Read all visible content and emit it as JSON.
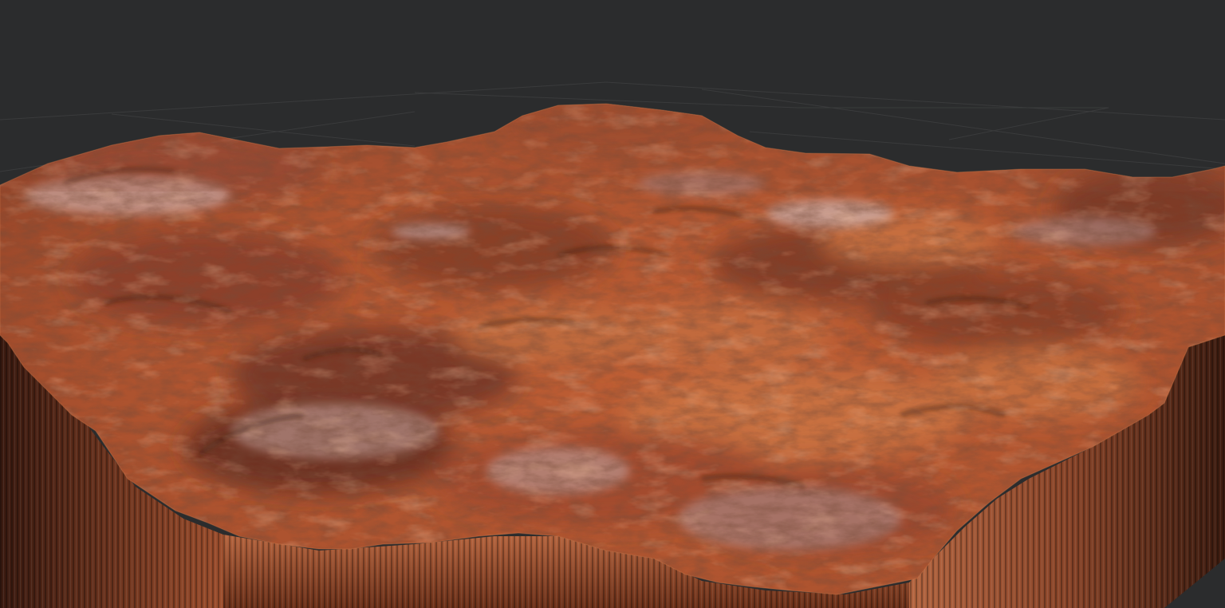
{
  "viewport": {
    "background_color": "#2b2c2d",
    "grid_color": "#3a3b3c",
    "grid_visible": true
  },
  "terrain": {
    "surface_base_color": "#b4552f",
    "surface_highlight_color": "#d06e3e",
    "surface_shadow_color": "#5e2a1a",
    "rock_exposed_color": "#c9aaa6",
    "cliff_side_color": "#8a4529"
  }
}
